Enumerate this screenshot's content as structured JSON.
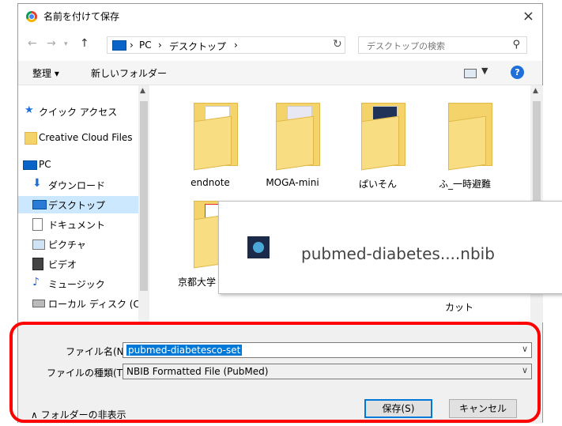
{
  "title_bar": {
    "title": "名前を付けて保存",
    "close": "×"
  },
  "address": {
    "crumbs": [
      "PC",
      "デスクトップ"
    ],
    "separator": "›",
    "search_placeholder": "デスクトップの検索"
  },
  "toolbar": {
    "organize": "整理 ▾",
    "new_folder": "新しいフォルダー",
    "help": "?"
  },
  "nav": {
    "items": [
      {
        "label": "クイック アクセス",
        "icon": "star-icon"
      },
      {
        "label": "Creative Cloud Files",
        "icon": "folder-icon"
      },
      {
        "label": "PC",
        "icon": "pc-icon"
      },
      {
        "label": "ダウンロード",
        "icon": "download-arrow-icon"
      },
      {
        "label": "デスクトップ",
        "icon": "desktop-icon"
      },
      {
        "label": "ドキュメント",
        "icon": "document-icon"
      },
      {
        "label": "ピクチャ",
        "icon": "pictures-icon"
      },
      {
        "label": "ビデオ",
        "icon": "video-icon"
      },
      {
        "label": "ミュージック",
        "icon": "music-icon"
      },
      {
        "label": "ローカル ディスク (C:)",
        "icon": "disk-icon"
      }
    ]
  },
  "files": {
    "row1": [
      "endnote",
      "MOGA-mini",
      "ぱいそん",
      "ふ_一時避難"
    ],
    "row2_first": "京都大学",
    "row2_last": "カット"
  },
  "popup": {
    "filename": "pubmed-diabetes....nbib"
  },
  "form": {
    "filename_label": "ファイル名(N):",
    "filename_value": "pubmed-diabetesco-set",
    "filetype_label": "ファイルの種類(T):",
    "filetype_value": "NBIB Formatted File (PubMed)",
    "hide_folders": "フォルダーの非表示",
    "save": "保存(S)",
    "cancel": "キャンセル"
  },
  "colors": {
    "highlight": "#ff0000",
    "selection": "#0078d7",
    "folder": "#f5d36b"
  }
}
